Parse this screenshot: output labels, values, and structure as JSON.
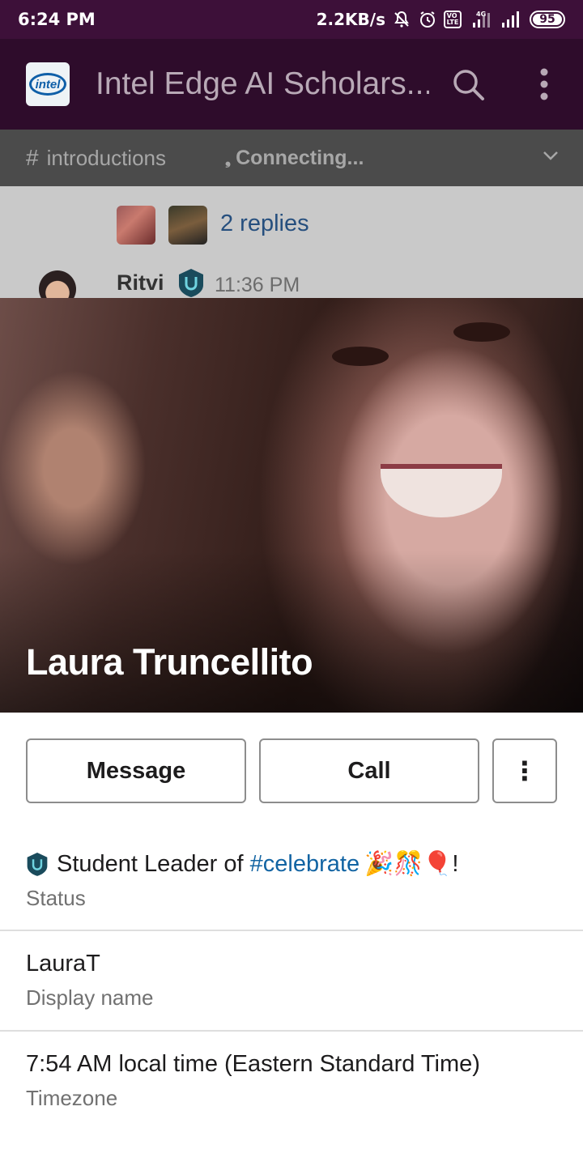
{
  "status_bar": {
    "time": "6:24 PM",
    "net_speed": "2.2KB/s",
    "battery": "95",
    "icons": [
      "mute-alarm-icon",
      "alarm-clock-icon",
      "volte-icon",
      "signal-4g-icon",
      "signal-icon",
      "battery-icon"
    ]
  },
  "header": {
    "workspace_logo": "intel",
    "workspace_name": "Intel Edge AI Scholars...",
    "actions": [
      "search-icon",
      "kebab-menu-icon"
    ]
  },
  "channel_bar": {
    "hash": "#",
    "channel": "introductions",
    "connection_status": "Connecting...",
    "icon": "chevron-down-icon"
  },
  "thread_preview": {
    "replies": "2 replies",
    "author": "Ritvi",
    "time": "11:36 PM"
  },
  "profile": {
    "name": "Laura Truncellito",
    "buttons": {
      "message": "Message",
      "call": "Call",
      "more": "⋮"
    },
    "status": {
      "text": "Student Leader of ",
      "channel_link": "#celebrate",
      "emoji": "🎉🎊🎈",
      "suffix": "!",
      "label": "Status"
    },
    "display_name": {
      "value": "LauraT",
      "label": "Display name"
    },
    "timezone": {
      "value": "7:54 AM local time (Eastern Standard Time)",
      "label": "Timezone"
    }
  },
  "colors": {
    "status_bar_bg": "#3d1039",
    "header_bg": "#2e0c2b",
    "channel_bar_bg": "#4b4b4b",
    "link": "#1264a3",
    "badge": "#1a4b5c"
  }
}
